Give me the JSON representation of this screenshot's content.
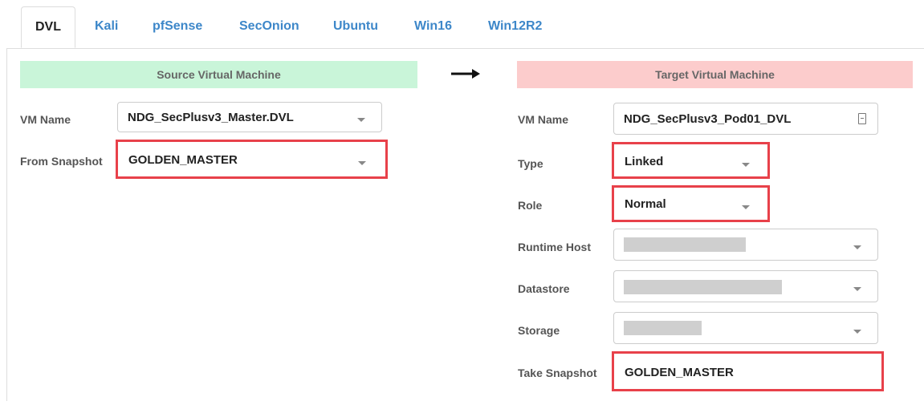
{
  "tabs": [
    {
      "label": "DVL",
      "active": true
    },
    {
      "label": "Kali",
      "active": false
    },
    {
      "label": "pfSense",
      "active": false
    },
    {
      "label": "SecOnion",
      "active": false
    },
    {
      "label": "Ubuntu",
      "active": false
    },
    {
      "label": "Win16",
      "active": false
    },
    {
      "label": "Win12R2",
      "active": false
    }
  ],
  "source": {
    "banner": "Source Virtual Machine",
    "vm_name_label": "VM Name",
    "vm_name_value": "NDG_SecPlusv3_Master.DVL",
    "snapshot_label": "From Snapshot",
    "snapshot_value": "GOLDEN_MASTER"
  },
  "target": {
    "banner": "Target Virtual Machine",
    "vm_name_label": "VM Name",
    "vm_name_value": "NDG_SecPlusv3_Pod01_DVL",
    "type_label": "Type",
    "type_value": "Linked",
    "role_label": "Role",
    "role_value": "Normal",
    "runtime_host_label": "Runtime Host",
    "datastore_label": "Datastore",
    "storage_label": "Storage",
    "take_snapshot_label": "Take Snapshot",
    "take_snapshot_value": "GOLDEN_MASTER"
  },
  "colors": {
    "source_banner": "#c9f5d9",
    "target_banner": "#fccccc",
    "highlight": "#e8414a",
    "tab_link": "#3d87c9"
  },
  "icons": {
    "arrow": "arrow-right-icon",
    "caret": "chevron-down-icon",
    "name_field": "save-icon"
  }
}
